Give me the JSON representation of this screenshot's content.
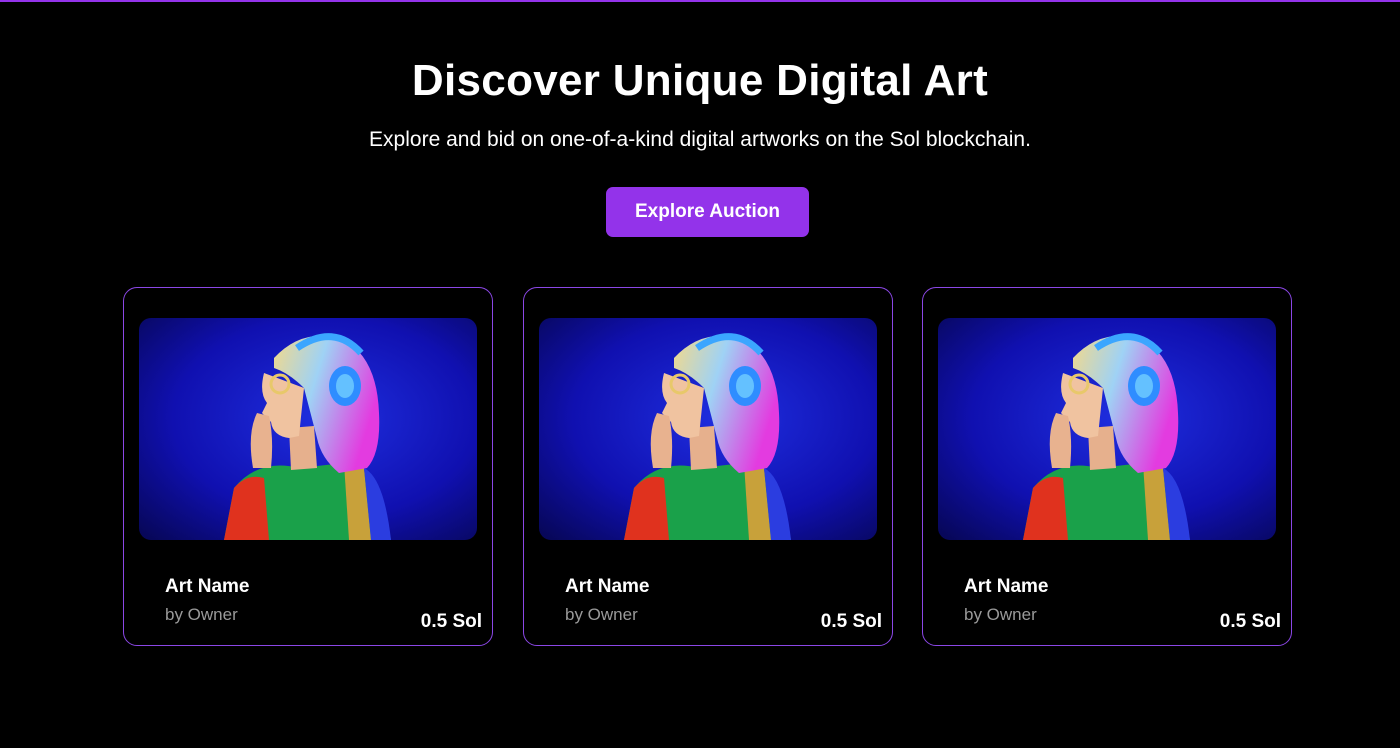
{
  "hero": {
    "title": "Discover Unique Digital Art",
    "subtitle": "Explore and bid on one-of-a-kind digital artworks on the Sol blockchain.",
    "cta_label": "Explore Auction"
  },
  "colors": {
    "accent": "#9333ea",
    "background": "#000000",
    "card_border": "#8b47e6",
    "muted_text": "#9a9a9a"
  },
  "cards": [
    {
      "name": "Art Name",
      "owner": "by Owner",
      "price": "0.5 Sol",
      "image": "neon-portrait-headphones"
    },
    {
      "name": "Art Name",
      "owner": "by Owner",
      "price": "0.5 Sol",
      "image": "neon-portrait-headphones"
    },
    {
      "name": "Art Name",
      "owner": "by Owner",
      "price": "0.5 Sol",
      "image": "neon-portrait-headphones"
    }
  ]
}
